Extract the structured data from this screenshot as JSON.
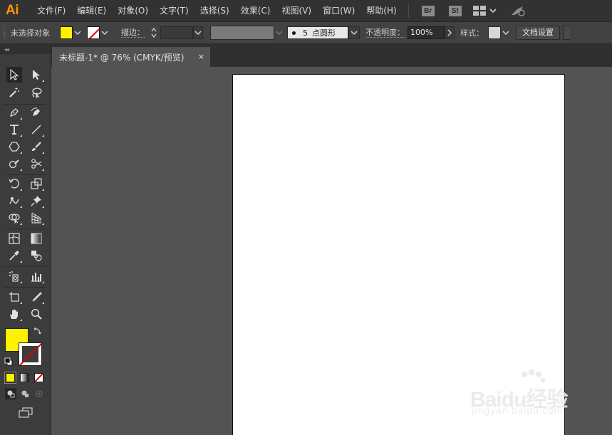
{
  "app": {
    "logo": "Ai"
  },
  "menu": [
    "文件(F)",
    "编辑(E)",
    "对象(O)",
    "文字(T)",
    "选择(S)",
    "效果(C)",
    "视图(V)",
    "窗口(W)",
    "帮助(H)"
  ],
  "menubar_badges": {
    "bridge": "Br",
    "stock": "St"
  },
  "control": {
    "no_selection": "未选择对象",
    "fill_color": "#fff200",
    "stroke_label": "描边：",
    "brush_size": "5",
    "brush_name": "点圆形",
    "opacity_label": "不透明度：",
    "opacity_value": "100%",
    "style_label": "样式：",
    "doc_setup": "文档设置"
  },
  "document": {
    "tab_title": "未标题-1* @ 76% (CMYK/预览)",
    "close_glyph": "×"
  },
  "toolbox": {
    "collapse_glyph": "◂◂",
    "fill_color": "#fff200",
    "stroke": "none"
  },
  "watermark": {
    "brand": "Baidu经验",
    "url": "jingyan.baidu.com"
  }
}
